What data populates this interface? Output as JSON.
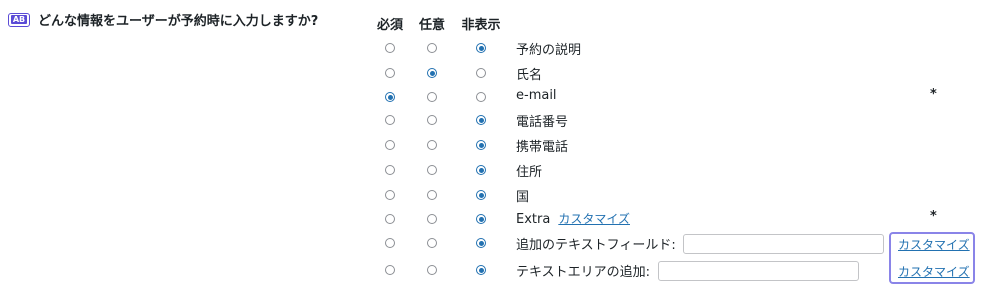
{
  "question": "どんな情報をユーザーが予約時に入力しますか?",
  "icon_text": "AB",
  "columns": {
    "required": "必須",
    "optional": "任意",
    "hidden": "非表示"
  },
  "rows": [
    {
      "label": "予約の説明",
      "selected": "hidden",
      "required_mark": ""
    },
    {
      "label": "氏名",
      "selected": "optional",
      "required_mark": ""
    },
    {
      "label": "e-mail",
      "selected": "required",
      "required_mark": "*"
    },
    {
      "label": "電話番号",
      "selected": "hidden",
      "required_mark": ""
    },
    {
      "label": "携帯電話",
      "selected": "hidden",
      "required_mark": ""
    },
    {
      "label": "住所",
      "selected": "hidden",
      "required_mark": ""
    },
    {
      "label": "国",
      "selected": "hidden",
      "required_mark": ""
    },
    {
      "label": "Extra",
      "selected": "hidden",
      "required_mark": "*",
      "link": "カスタマイズ"
    },
    {
      "label": "追加のテキストフィールド:",
      "selected": "hidden",
      "required_mark": "",
      "input_value": "",
      "link": "カスタマイズ"
    },
    {
      "label": "テキストエリアの追加:",
      "selected": "hidden",
      "required_mark": "",
      "input_value": "",
      "link": "カスタマイズ"
    }
  ],
  "colors": {
    "accent": "#2271b1",
    "icon": "#5b4bd6",
    "highlight": "#8a84e8"
  }
}
